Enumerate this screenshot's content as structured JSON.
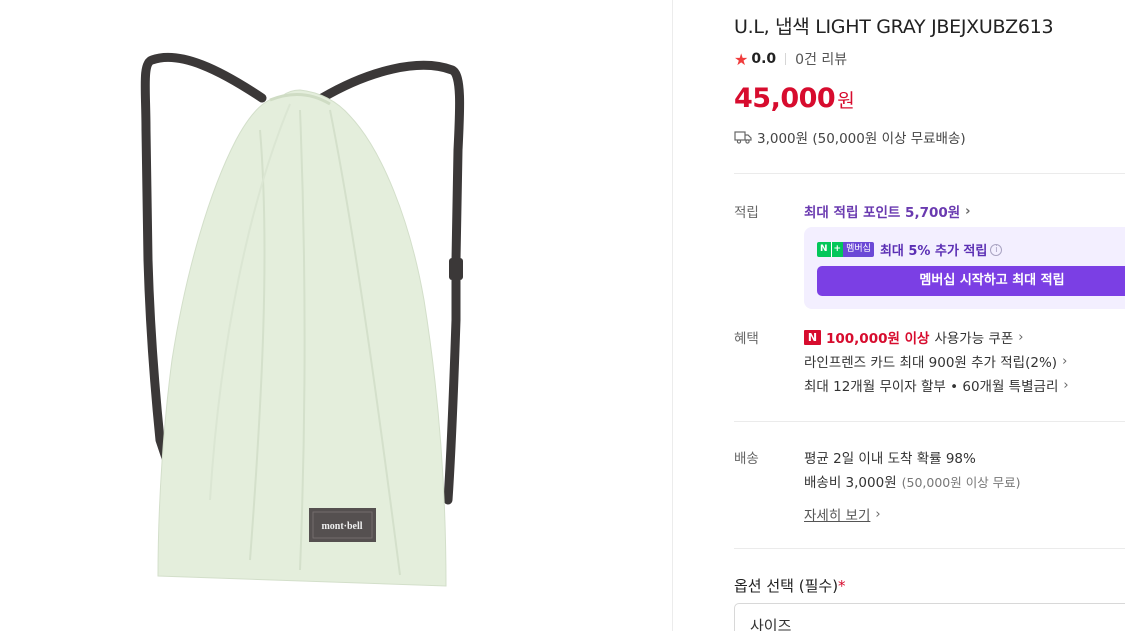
{
  "product": {
    "title": "U.L, 냅색 LIGHT GRAY JBEJXUBZ613",
    "rating": "0.0",
    "review_count": "0건 리뷰",
    "price": "45,000",
    "price_unit": "원",
    "shipping": "3,000원 (50,000원 이상 무료배송)"
  },
  "image": {
    "brand": "mont·bell",
    "bag_color": "#e4eedc",
    "strap_color": "#3b3838"
  },
  "points": {
    "label": "적립",
    "max_points_text": "최대 적립 포인트",
    "max_points_amount": "5,700원",
    "badge_n": "N",
    "badge_plus": "+",
    "badge_membership": "멤버십",
    "membership_text": "최대 5% 추가 적립",
    "membership_button": "멤버십 시작하고 최대 적립"
  },
  "benefits": {
    "label": "혜택",
    "coupon_badge": "N",
    "coupon_amount": "100,000원 이상",
    "coupon_text": "사용가능 쿠폰",
    "card_text": "라인프렌즈 카드 최대 900원 추가 적립(2%)",
    "installment_text": "최대 12개월 무이자 할부 • 60개월 특별금리"
  },
  "delivery": {
    "label": "배송",
    "arrival": "평균 2일 이내 도착 확률 98%",
    "fee": "배송비 3,000원",
    "fee_note": "(50,000원 이상 무료)",
    "details_link": "자세히 보기"
  },
  "options": {
    "title": "옵션 선택 (필수)",
    "required_mark": "*",
    "size_placeholder": "사이즈"
  },
  "colors": {
    "price_red": "#d70c2e",
    "accent_purple": "#7b3fe4",
    "naver_green": "#03c75a"
  }
}
